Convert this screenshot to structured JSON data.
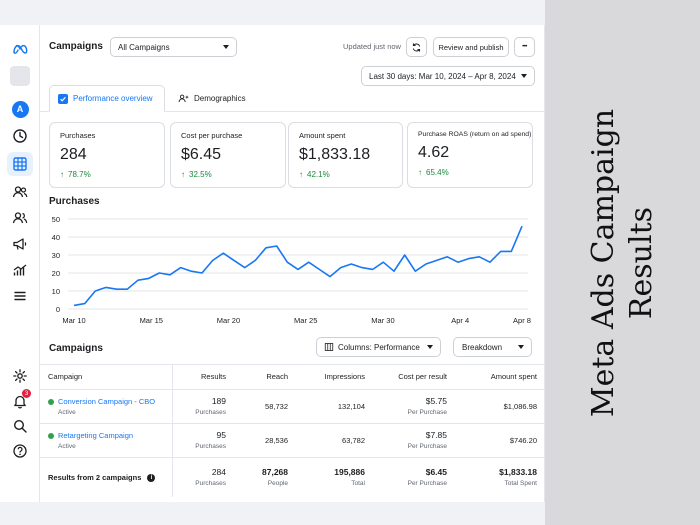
{
  "header": {
    "title": "Campaigns",
    "campaign_filter": "All Campaigns",
    "updated": "Updated just now",
    "review_button": "Review and publish",
    "more": "•••",
    "date_range": "Last 30 days: Mar 10, 2024 – Apr 8, 2024"
  },
  "sidebar": {
    "avatar": "A",
    "badge_count": "3"
  },
  "tabs": [
    {
      "label": "Performance overview"
    },
    {
      "label": "Demographics"
    }
  ],
  "kpis": [
    {
      "label": "Purchases",
      "value": "284",
      "change": "78.7%"
    },
    {
      "label": "Cost per purchase",
      "value": "$6.45",
      "change": "32.5%"
    },
    {
      "label": "Amount spent",
      "value": "$1,833.18",
      "change": "42.1%"
    },
    {
      "label": "Purchase ROAS (return on ad spend)",
      "value": "4.62",
      "change": "65.4%"
    }
  ],
  "chart_data": {
    "type": "line",
    "title": "Purchases",
    "x_ticks": [
      "Mar 10",
      "Mar 15",
      "Mar 20",
      "Mar 25",
      "Mar 30",
      "Apr 4",
      "Apr 8"
    ],
    "y_ticks": [
      "0",
      "10",
      "20",
      "30",
      "40",
      "50"
    ],
    "ylim": [
      0,
      50
    ],
    "color": "#1877f2",
    "grid": true,
    "x": [
      "Mar 10",
      "Mar 11",
      "Mar 12",
      "Mar 13",
      "Mar 14",
      "Mar 15",
      "Mar 16",
      "Mar 17",
      "Mar 18",
      "Mar 19",
      "Mar 20",
      "Mar 21",
      "Mar 22",
      "Mar 23",
      "Mar 24",
      "Mar 25",
      "Mar 26",
      "Mar 27",
      "Mar 28",
      "Mar 29",
      "Mar 30",
      "Mar 31",
      "Apr 1",
      "Apr 2",
      "Apr 3",
      "Apr 4",
      "Apr 5",
      "Apr 6",
      "Apr 7",
      "Apr 8"
    ],
    "values": [
      2,
      3,
      10,
      12,
      11,
      11,
      16,
      17,
      20,
      19,
      23,
      21,
      20,
      27,
      31,
      27,
      23,
      27,
      34,
      35,
      26,
      22,
      26,
      22,
      18,
      23,
      25,
      23,
      22,
      26,
      21,
      30,
      21,
      25,
      27,
      29,
      26,
      28,
      29,
      26,
      32,
      32,
      46
    ],
    "series_name": ""
  },
  "chart_labels": {
    "section_title": "Purchases"
  },
  "campaigns": {
    "title": "Campaigns",
    "columns_button": "Columns: Performance",
    "breakdown_button": "Breakdown",
    "headers": [
      "Campaign",
      "Results",
      "Reach",
      "Impressions",
      "Cost per result",
      "Amount spent"
    ],
    "rows": [
      {
        "name": "Conversion Campaign - CBO",
        "status": "Active",
        "results": "189",
        "results_unit": "Purchases",
        "reach": "58,732",
        "impressions": "132,104",
        "cpr": "$5.75",
        "cpr_unit": "Per Purchase",
        "spent": "$1,086.98"
      },
      {
        "name": "Retargeting Campaign",
        "status": "Active",
        "results": "95",
        "results_unit": "Purchases",
        "reach": "28,536",
        "impressions": "63,782",
        "cpr": "$7.85",
        "cpr_unit": "Per Purchase",
        "spent": "$746.20"
      }
    ],
    "total": {
      "label": "Results from 2 campaigns",
      "results": "284",
      "results_unit": "Purchases",
      "reach": "87,268",
      "reach_unit": "People",
      "impressions": "195,886",
      "impressions_unit": "Total",
      "cpr": "$6.45",
      "cpr_unit": "Per Purchase",
      "spent": "$1,833.18",
      "spent_unit": "Total Spent"
    }
  },
  "side_title": {
    "line1": "Meta Ads Campaign",
    "line2": "Results"
  },
  "colors": {
    "accent": "#1877f2",
    "positive": "#1a8a3a",
    "active_dot": "#31a24c"
  }
}
